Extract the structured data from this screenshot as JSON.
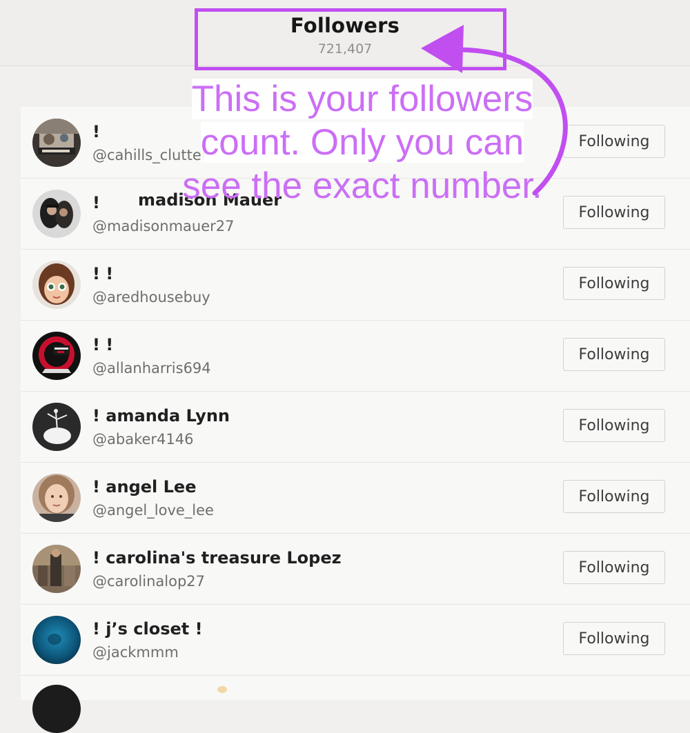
{
  "header": {
    "title": "Followers",
    "count": "721,407"
  },
  "followers": [
    {
      "name": "!",
      "display_name": "",
      "handle": "@cahills_clutter",
      "button": "Following"
    },
    {
      "name": "!",
      "display_name": "madison Mauer",
      "handle": "@madisonmauer27",
      "button": "Following"
    },
    {
      "name": "! !",
      "display_name": "",
      "handle": "@aredhousebuy",
      "button": "Following"
    },
    {
      "name": "! !",
      "display_name": "",
      "handle": "@allanharris694",
      "button": "Following"
    },
    {
      "name": "! amanda Lynn",
      "display_name": "",
      "handle": "@abaker4146",
      "button": "Following"
    },
    {
      "name": "! angel Lee",
      "display_name": "",
      "handle": "@angel_love_lee",
      "button": "Following"
    },
    {
      "name": "! carolina's treasure Lopez",
      "display_name": "",
      "handle": "@carolinalop27",
      "button": "Following"
    },
    {
      "name": "! j’s closet !",
      "display_name": "",
      "handle": "@jackmmm",
      "button": "Following"
    }
  ],
  "annotation": {
    "line1": "This is your followers",
    "line2": "count. Only you can",
    "line3": "see the exact number.",
    "color": "#cb6ff5",
    "box_color": "#c14ff0"
  },
  "icons": {
    "avatar": "user-avatar"
  }
}
